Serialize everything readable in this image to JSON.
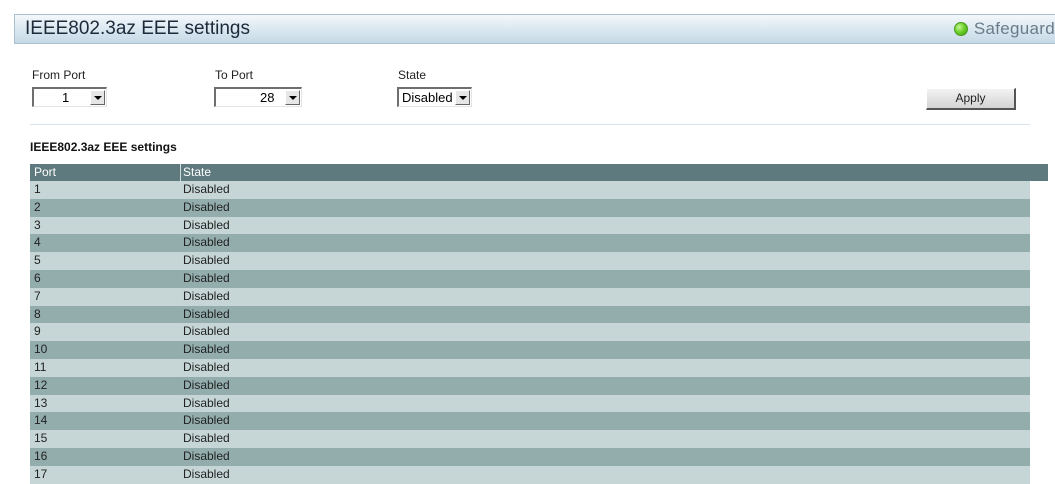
{
  "header": {
    "title": "IEEE802.3az EEE settings",
    "safeguard_label": "Safeguard",
    "safeguard_color": "#5fcf2a"
  },
  "form": {
    "from_port": {
      "label": "From Port",
      "value": "1"
    },
    "to_port": {
      "label": "To Port",
      "value": "28"
    },
    "state": {
      "label": "State",
      "value": "Disabled"
    },
    "apply_label": "Apply"
  },
  "table": {
    "section_title": "IEEE802.3az EEE settings",
    "columns": [
      "Port",
      "State"
    ],
    "rows": [
      {
        "port": "1",
        "state": "Disabled"
      },
      {
        "port": "2",
        "state": "Disabled"
      },
      {
        "port": "3",
        "state": "Disabled"
      },
      {
        "port": "4",
        "state": "Disabled"
      },
      {
        "port": "5",
        "state": "Disabled"
      },
      {
        "port": "6",
        "state": "Disabled"
      },
      {
        "port": "7",
        "state": "Disabled"
      },
      {
        "port": "8",
        "state": "Disabled"
      },
      {
        "port": "9",
        "state": "Disabled"
      },
      {
        "port": "10",
        "state": "Disabled"
      },
      {
        "port": "11",
        "state": "Disabled"
      },
      {
        "port": "12",
        "state": "Disabled"
      },
      {
        "port": "13",
        "state": "Disabled"
      },
      {
        "port": "14",
        "state": "Disabled"
      },
      {
        "port": "15",
        "state": "Disabled"
      },
      {
        "port": "16",
        "state": "Disabled"
      },
      {
        "port": "17",
        "state": "Disabled"
      }
    ]
  }
}
